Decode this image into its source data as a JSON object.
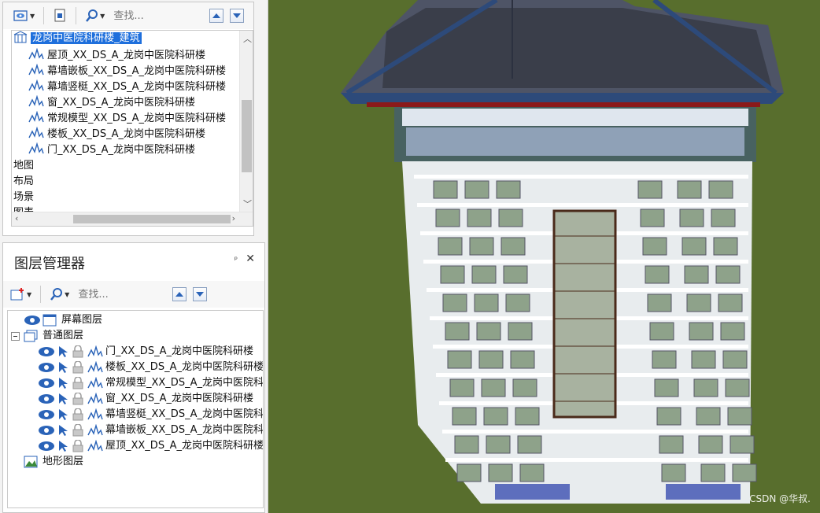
{
  "catalog": {
    "search_placeholder": "查找...",
    "selected_item": "龙岗中医院科研楼_建筑",
    "children": [
      "屋顶_XX_DS_A_龙岗中医院科研楼",
      "幕墙嵌板_XX_DS_A_龙岗中医院科研楼",
      "幕墙竖梃_XX_DS_A_龙岗中医院科研楼",
      "窗_XX_DS_A_龙岗中医院科研楼",
      "常规模型_XX_DS_A_龙岗中医院科研楼",
      "楼板_XX_DS_A_龙岗中医院科研楼",
      "门_XX_DS_A_龙岗中医院科研楼"
    ],
    "root_items": [
      "地图",
      "布局",
      "场景",
      "图表"
    ]
  },
  "layer_manager": {
    "title": "图层管理器",
    "pin": "ᵖ",
    "close": "✕",
    "search_placeholder": "查找...",
    "screen_layer": "屏幕图层",
    "normal_layer": "普通图层",
    "normal_children": [
      "门_XX_DS_A_龙岗中医院科研楼",
      "楼板_XX_DS_A_龙岗中医院科研楼",
      "常规模型_XX_DS_A_龙岗中医院科研楼",
      "窗_XX_DS_A_龙岗中医院科研楼",
      "幕墙竖梃_XX_DS_A_龙岗中医院科研楼",
      "幕墙嵌板_XX_DS_A_龙岗中医院科研楼",
      "屋顶_XX_DS_A_龙岗中医院科研楼"
    ],
    "terrain_layer": "地形图层"
  },
  "scene": {
    "background_color": "#586e2d",
    "watermark": "CSDN @华叔."
  }
}
